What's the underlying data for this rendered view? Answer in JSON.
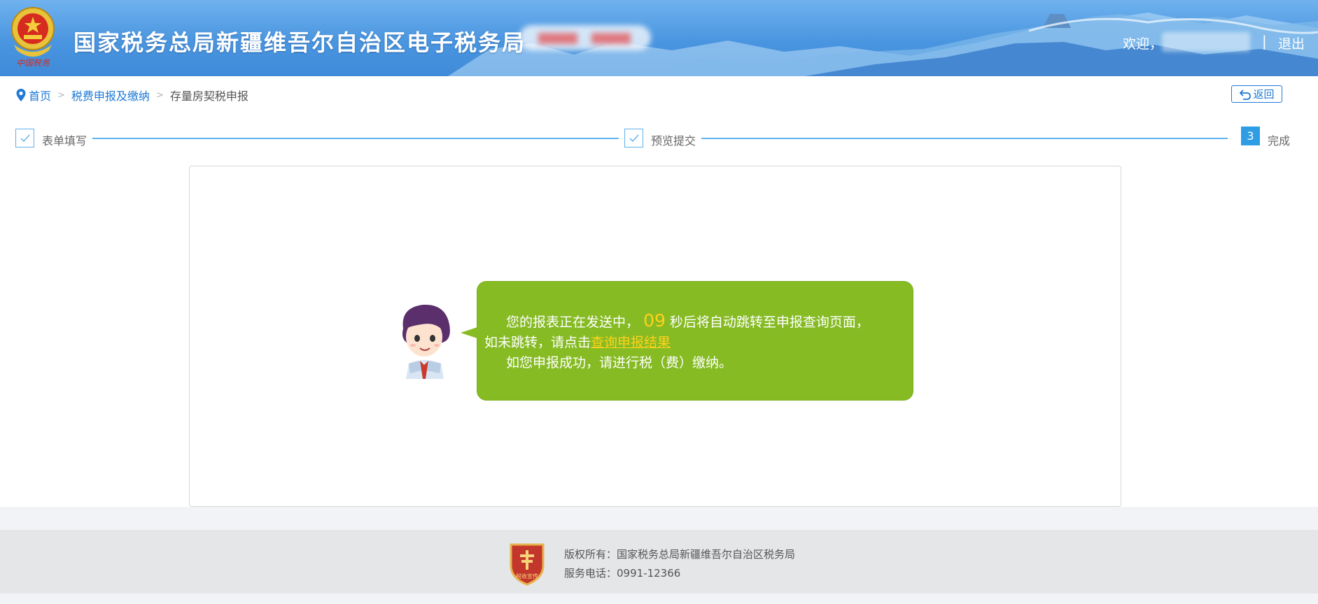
{
  "header": {
    "title": "国家税务总局新疆维吾尔自治区电子税务局",
    "welcome": "欢迎，",
    "separator": "|",
    "logout": "退出",
    "emblem_text": "中国税务"
  },
  "breadcrumb": {
    "home": "首页",
    "level1": "税费申报及缴纳",
    "current": "存量房契税申报",
    "separator": ">"
  },
  "back_button": "返回",
  "steps": [
    {
      "label": "表单填写",
      "status": "done"
    },
    {
      "label": "预览提交",
      "status": "done"
    },
    {
      "label": "完成",
      "number": "3",
      "status": "active"
    }
  ],
  "message": {
    "line1_before": "您的报表正在发送中，",
    "countdown": "09",
    "line1_after": "秒后将自动跳转至申报查询页面，",
    "line2_before": "如未跳转，请点击",
    "line2_link": "查询申报结果",
    "line3": "如您申报成功，请进行税（费）缴纳。"
  },
  "footer": {
    "copyright": "版权所有：国家税务总局新疆维吾尔自治区税务局",
    "phone": "服务电话：0991-12366",
    "logo_text": "税收宣传"
  },
  "colors": {
    "header_blue": "#4a95e0",
    "link_blue": "#1f7ad6",
    "step_blue": "#2e9de4",
    "bubble_green": "#86bb24",
    "countdown_yellow": "#ffd11a",
    "emblem_red": "#d62b1f"
  }
}
